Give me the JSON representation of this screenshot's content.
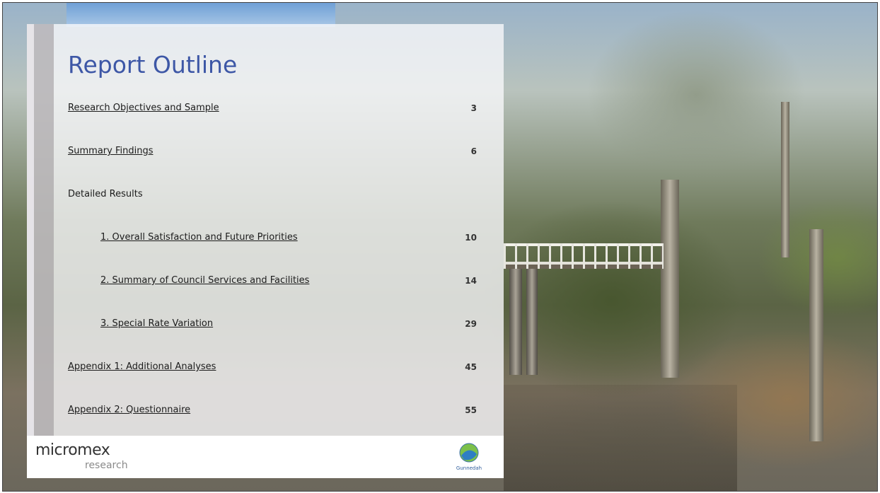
{
  "slide": {
    "title": "Report Outline",
    "toc": [
      {
        "label": "Research Objectives and Sample",
        "page": "3",
        "link": true
      },
      {
        "label": "Summary Findings",
        "page": "6",
        "link": true
      },
      {
        "label": "Detailed Results",
        "page": "",
        "link": false
      },
      {
        "label": "1. Overall Satisfaction and Future Priorities",
        "page": "10",
        "link": true
      },
      {
        "label": "2. Summary of Council Services and Facilities",
        "page": "14",
        "link": true
      },
      {
        "label": "3. Special Rate Variation",
        "page": "29",
        "link": true
      },
      {
        "label": "Appendix 1: Additional Analyses",
        "page": "45",
        "link": true
      },
      {
        "label": "Appendix 2: Questionnaire",
        "page": "55",
        "link": true
      }
    ]
  },
  "footer": {
    "left_logo": {
      "main": "micromex",
      "sub": "research"
    },
    "right_logo": {
      "icon": "gunnedah-shire-council-logo",
      "text": "Gunnedah"
    }
  },
  "colors": {
    "title": "#3d57a6",
    "panel": "#f7f8fa",
    "side_bar": "#bebabe"
  }
}
